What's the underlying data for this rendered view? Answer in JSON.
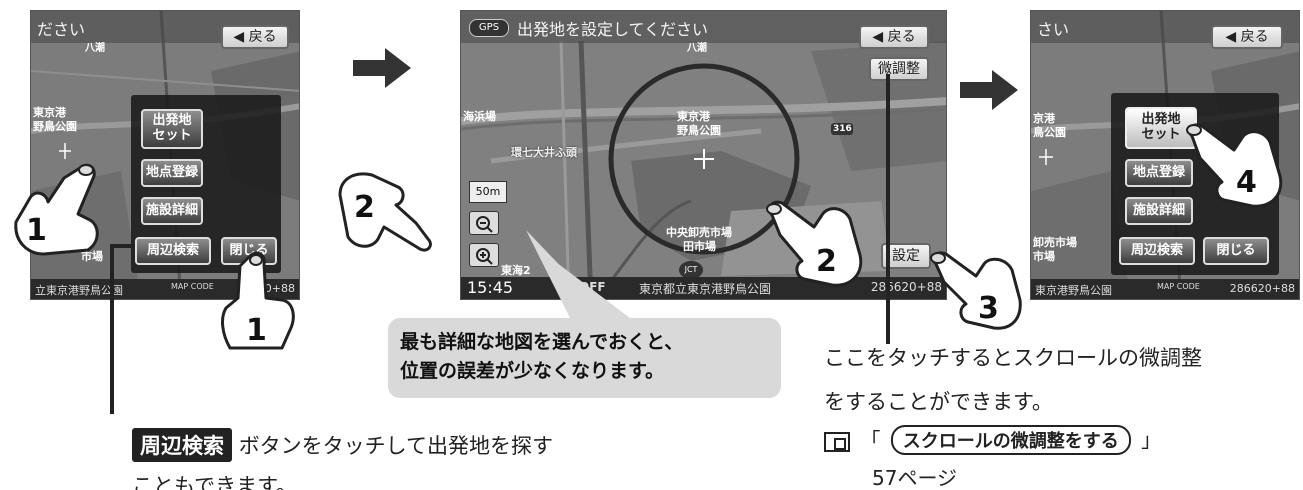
{
  "screen1": {
    "title": "ださい",
    "area_label": "八潮",
    "back_label": "◀ 戻る",
    "map_labels": [
      "東京港",
      "野鳥公園",
      "市場"
    ],
    "menu_buttons": [
      "出発地\nセット",
      "地点登録",
      "施設詳細",
      "周辺検索",
      "閉じる"
    ],
    "bottom_left": "立東京港野鳥公園",
    "bottom_right": "620+88",
    "mapcode": "MAP CODE"
  },
  "screen2": {
    "gps_label": "GPS",
    "title": "出発地を設定してください",
    "area_label": "八潮",
    "back_label": "◀ 戻る",
    "fine_adjust_label": "微調整",
    "map_labels": [
      "海浜場",
      "環七大井ふ頭",
      "東京港",
      "野鳥公園",
      "中央卸売市場",
      "田市場",
      "東海2"
    ],
    "route_number": "316",
    "scale_label": "50m",
    "zoom_out_icon": "zoom-out-icon",
    "zoom_in_icon": "zoom-in-icon",
    "set_label": "設定",
    "time": "15:45",
    "off_label": "OFF",
    "jct_label": "JCT",
    "bottom_place": "東京都立東京港野鳥公園",
    "bottom_right": "286620+88"
  },
  "screen3": {
    "title": "さい",
    "back_label": "◀ 戻る",
    "map_labels": [
      "京港",
      "鳥公園",
      "卸売市場",
      "市場"
    ],
    "menu_buttons": [
      "出発地\nセット",
      "地点登録",
      "施設詳細",
      "周辺検索",
      "閉じる"
    ],
    "bottom_left": "東京港野鳥公園",
    "bottom_right": "286620+88",
    "mapcode": "MAP CODE"
  },
  "steps": [
    "1",
    "1",
    "2",
    "2",
    "3",
    "4"
  ],
  "note": {
    "line1": "最も詳細な地図を選んでおくと、",
    "line2": "位置の誤差が少なくなります。"
  },
  "caption_left": {
    "tag": "周辺検索",
    "text": "ボタンをタッチして出発地を探す",
    "text2": "こともできます。"
  },
  "caption_right": {
    "line1": "ここをタッチするとスクロールの微調整",
    "line2": "をすることができます。",
    "ref_open": "「",
    "ref_title": "スクロールの微調整をする",
    "ref_close": "」",
    "ref_page": "57ページ"
  },
  "colors": {
    "map_gray": "#7e7e7e",
    "panel": "#1e1e1e",
    "note_bg": "#d9d9d9",
    "arrow": "#333333"
  }
}
